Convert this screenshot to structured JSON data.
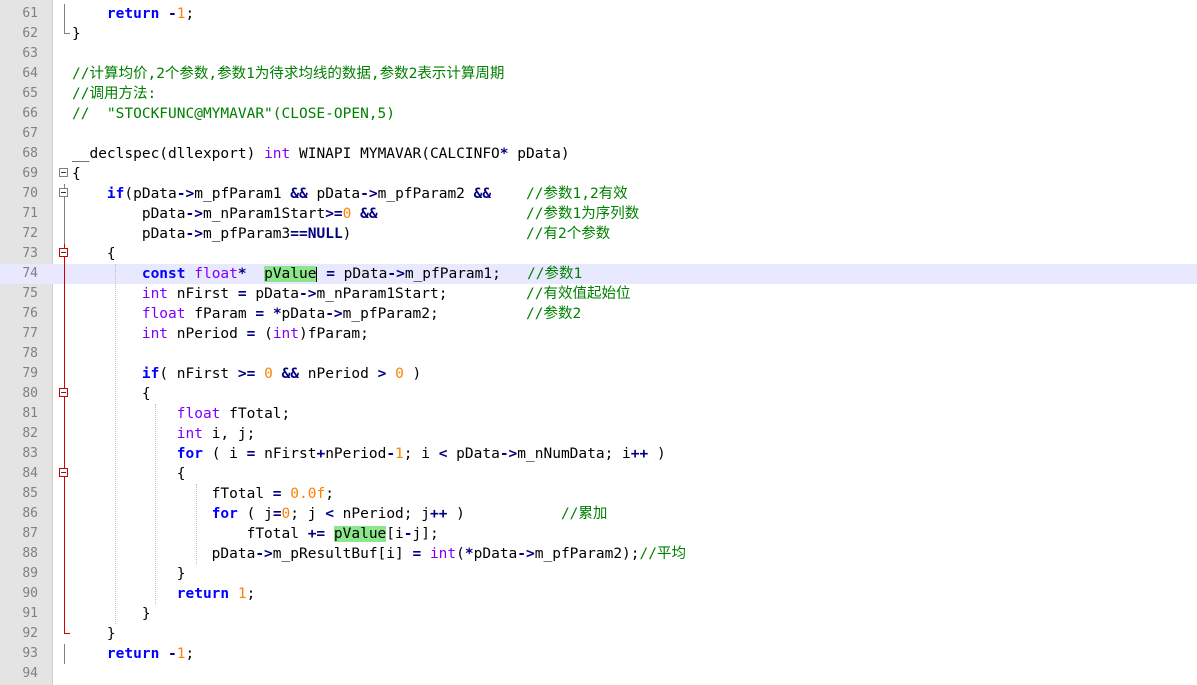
{
  "editor": {
    "lines": [
      {
        "num": "61",
        "text": "    return -1;"
      },
      {
        "num": "62",
        "text": "}"
      },
      {
        "num": "63",
        "text": ""
      },
      {
        "num": "64",
        "text": "//计算均价,2个参数,参数1为待求均线的数据,参数2表示计算周期"
      },
      {
        "num": "65",
        "text": "//调用方法:"
      },
      {
        "num": "66",
        "text": "//  \"STOCKFUNC@MYMAVAR\"(CLOSE-OPEN,5)"
      },
      {
        "num": "67",
        "text": ""
      },
      {
        "num": "68",
        "text": "__declspec(dllexport) int WINAPI MYMAVAR(CALCINFO* pData)"
      },
      {
        "num": "69",
        "text": "{"
      },
      {
        "num": "70",
        "text": "    if(pData->m_pfParam1 && pData->m_pfParam2 &&    //参数1,2有效"
      },
      {
        "num": "71",
        "text": "        pData->m_nParam1Start>=0 &&                 //参数1为序列数"
      },
      {
        "num": "72",
        "text": "        pData->m_pfParam3==NULL)                    //有2个参数"
      },
      {
        "num": "73",
        "text": "    {"
      },
      {
        "num": "74",
        "text": "        const float*  pValue = pData->m_pfParam1;   //参数1"
      },
      {
        "num": "75",
        "text": "        int nFirst = pData->m_nParam1Start;         //有效值起始位"
      },
      {
        "num": "76",
        "text": "        float fParam = *pData->m_pfParam2;          //参数2"
      },
      {
        "num": "77",
        "text": "        int nPeriod = (int)fParam;"
      },
      {
        "num": "78",
        "text": ""
      },
      {
        "num": "79",
        "text": "        if( nFirst >= 0 && nPeriod > 0 )"
      },
      {
        "num": "80",
        "text": "        {"
      },
      {
        "num": "81",
        "text": "            float fTotal;"
      },
      {
        "num": "82",
        "text": "            int i, j;"
      },
      {
        "num": "83",
        "text": "            for ( i = nFirst+nPeriod-1; i < pData->m_nNumData; i++ )"
      },
      {
        "num": "84",
        "text": "            {"
      },
      {
        "num": "85",
        "text": "                fTotal = 0.0f;"
      },
      {
        "num": "86",
        "text": "                for ( j=0; j < nPeriod; j++ )           //累加"
      },
      {
        "num": "87",
        "text": "                    fTotal += pValue[i-j];"
      },
      {
        "num": "88",
        "text": "                pData->m_pResultBuf[i] = int(*pData->m_pfParam2);//平均"
      },
      {
        "num": "89",
        "text": "            }"
      },
      {
        "num": "90",
        "text": "            return 1;"
      },
      {
        "num": "91",
        "text": "        }"
      },
      {
        "num": "92",
        "text": "    }"
      },
      {
        "num": "93",
        "text": "    return -1;"
      },
      {
        "num": "94",
        "text": ""
      }
    ]
  },
  "colors": {
    "keyword": "#0000ff",
    "type": "#8000ff",
    "comment": "#008000",
    "number": "#ff8000",
    "operator": "#000080",
    "highlight": "#8ce68c",
    "current_line": "#e8e8ff"
  }
}
